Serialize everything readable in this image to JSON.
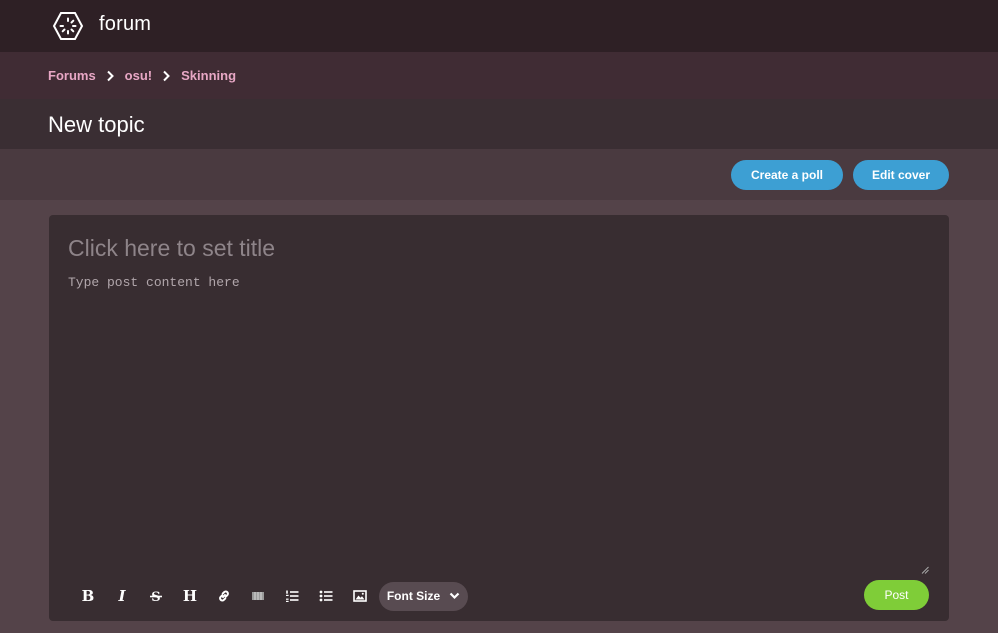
{
  "app": {
    "brand": "forum"
  },
  "breadcrumb": [
    "Forums",
    "osu!",
    "Skinning"
  ],
  "page": {
    "title": "New topic"
  },
  "actions": {
    "create_poll": "Create a poll",
    "edit_cover": "Edit cover"
  },
  "editor": {
    "title_placeholder": "Click here to set title",
    "body_placeholder": "Type post content here",
    "font_size_label": "Font Size",
    "post_label": "Post",
    "tools": [
      "bold",
      "italic",
      "strikethrough",
      "heading",
      "link",
      "spoiler",
      "ordered-list",
      "unordered-list",
      "image"
    ]
  },
  "colors": {
    "accent_blue": "#3d9fd3",
    "post_green": "#7fcd38",
    "crumb_pink": "#e8a7c5"
  }
}
